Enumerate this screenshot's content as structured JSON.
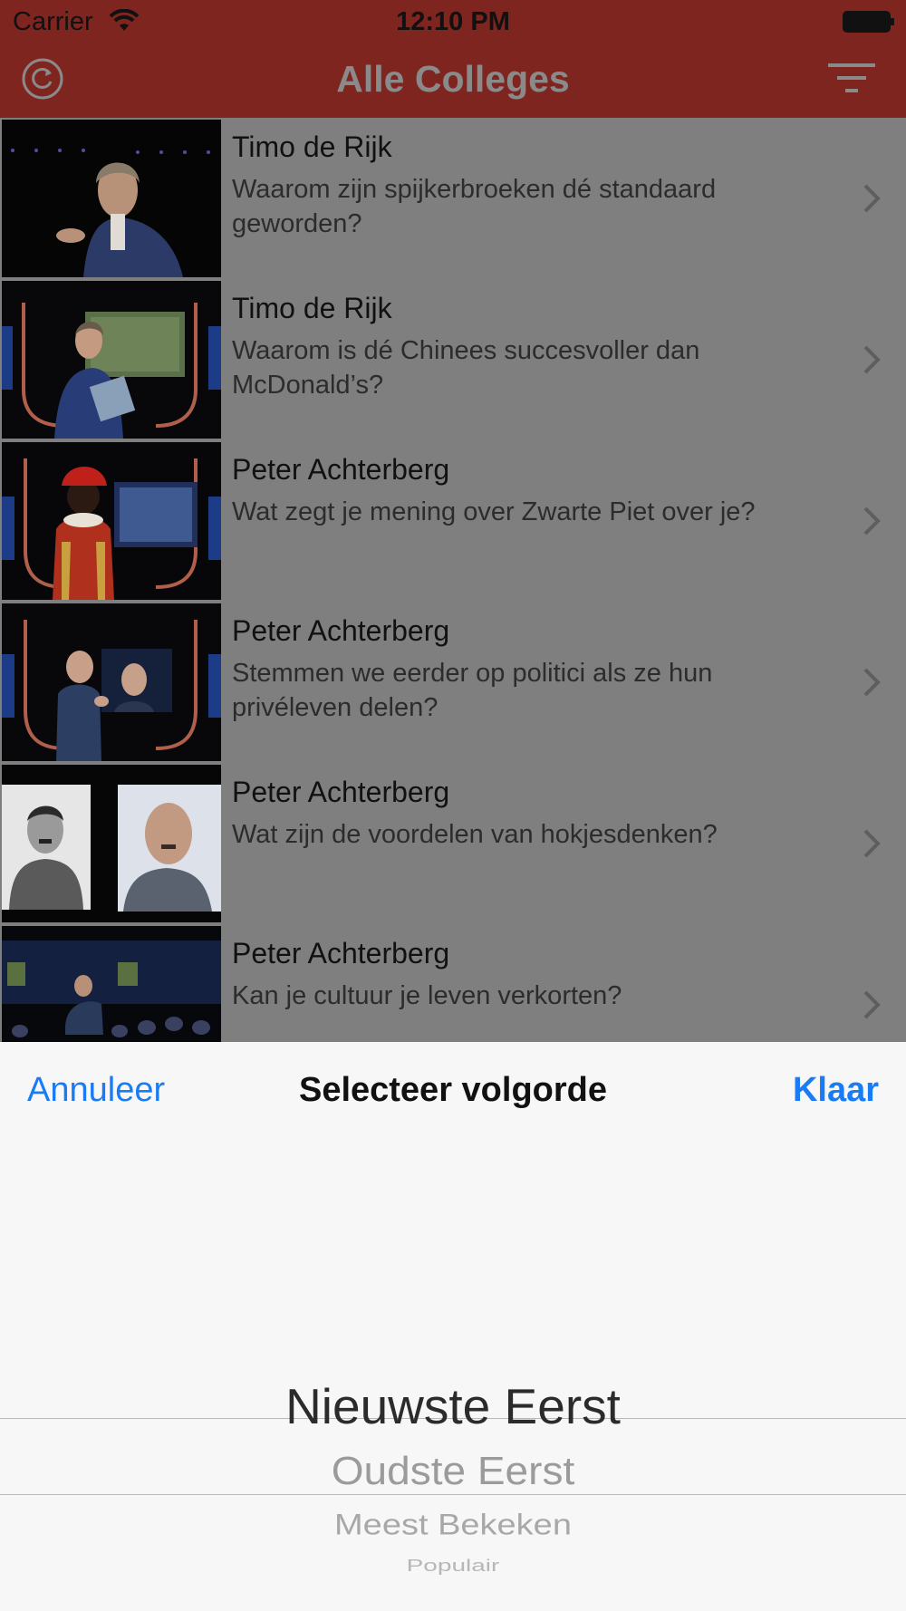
{
  "status_bar": {
    "carrier": "Carrier",
    "time": "12:10 PM"
  },
  "nav": {
    "title": "Alle Colleges",
    "left_icon": "refresh-icon",
    "right_icon": "filter-icon",
    "accent_color": "#c0392b"
  },
  "colleges": [
    {
      "speaker": "Timo de Rijk",
      "title": "Waarom zijn spijkerbroeken dé standaard geworden?"
    },
    {
      "speaker": "Timo de Rijk",
      "title": "Waarom is dé Chinees succesvoller dan McDonald’s?"
    },
    {
      "speaker": "Peter Achterberg",
      "title": "Wat zegt je mening over Zwarte Piet over je?"
    },
    {
      "speaker": "Peter Achterberg",
      "title": "Stemmen we eerder op politici als ze hun privéleven delen?"
    },
    {
      "speaker": "Peter Achterberg",
      "title": "Wat zijn de voordelen van hokjesdenken?"
    },
    {
      "speaker": "Peter Achterberg",
      "title": "Kan je cultuur je leven verkorten?"
    }
  ],
  "picker": {
    "title": "Selecteer volgorde",
    "cancel_label": "Annuleer",
    "done_label": "Klaar",
    "tint_color": "#1a7cf4",
    "selected": "Nieuwste Eerst",
    "options": [
      "Nieuwste Eerst",
      "Oudste Eerst",
      "Meest Bekeken",
      "Populair"
    ]
  }
}
